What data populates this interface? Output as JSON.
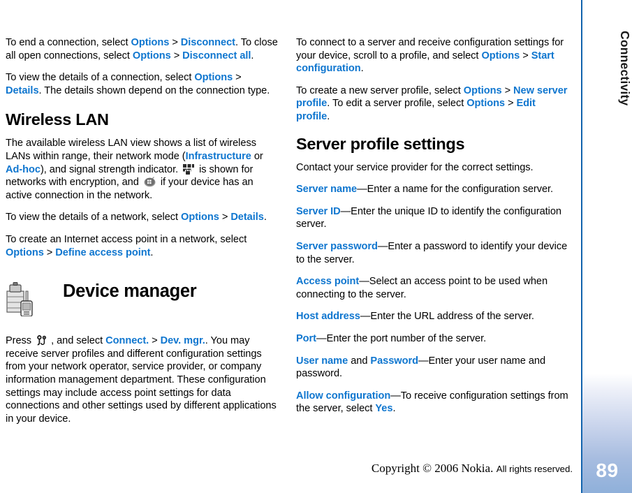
{
  "sidebar": {
    "chapter_label": "Connectivity",
    "page_number": "89",
    "accent_color": "#1263ad",
    "gradient_bottom_color": "#8fb0da"
  },
  "theme": {
    "link_color": "#0f76cf",
    "text_color": "#000000"
  },
  "left_column": {
    "p1": {
      "t1": "To end a connection, select ",
      "l1": "Options",
      "t2": " > ",
      "l2": "Disconnect",
      "t3": ". To close all open connections, select ",
      "l3": "Options",
      "t4": " > ",
      "l4": "Disconnect all",
      "t5": "."
    },
    "p2": {
      "t1": "To view the details of a connection, select ",
      "l1": "Options",
      "t2": " > ",
      "l2": "Details",
      "t3": ". The details shown depend on the connection type."
    },
    "heading_wireless_lan": "Wireless LAN",
    "p3": {
      "t1": "The available wireless LAN view shows a list of wireless LANs within range, their network mode (",
      "l1": "Infrastructure",
      "t2": " or ",
      "l2": "Ad-hoc",
      "t3": "), and signal strength indicator. ",
      "icon1": "wlan-encrypted-icon",
      "t4": " is shown for networks with encryption, and ",
      "icon2": "wlan-active-connection-icon",
      "t5": " if your device has an active connection in the network."
    },
    "p4": {
      "t1": "To view the details of a network, select ",
      "l1": "Options",
      "t2": " > ",
      "l2": "Details",
      "t3": "."
    },
    "p5": {
      "t1": "To create an Internet access point in a network, select ",
      "l1": "Options",
      "t2": " > ",
      "l2": "Define access point",
      "t3": "."
    },
    "chapter": {
      "icon": "device-manager-icon",
      "title": "Device manager"
    },
    "p6": {
      "t1": "Press ",
      "icon1": "menu-key-icon",
      "t2": ", and select ",
      "l1": "Connect.",
      "t3": " > ",
      "l2": "Dev. mgr.",
      "t4": ". You may receive server profiles and different configuration settings from your network operator, service provider, or company information management department. These configuration settings may include access point settings for data connections and other settings used by different applications in your device."
    }
  },
  "right_column": {
    "p1": {
      "t1": "To connect to a server and receive configuration settings for your device, scroll to a profile, and select ",
      "l1": "Options",
      "t2": " > ",
      "l2": "Start configuration",
      "t3": "."
    },
    "p2": {
      "t1": "To create a new server profile, select ",
      "l1": "Options",
      "t2": " > ",
      "l2": "New server profile",
      "t3": ". To edit a server profile, select ",
      "l3": "Options",
      "t4": " > ",
      "l4": "Edit profile",
      "t5": "."
    },
    "heading_server_profile_settings": "Server profile settings",
    "p3": {
      "t1": "Contact your service provider for the correct settings."
    },
    "p4": {
      "l1": "Server name",
      "t1": "—Enter a name for the configuration server."
    },
    "p5": {
      "l1": "Server ID",
      "t1": "—Enter the unique ID to identify the configuration server."
    },
    "p6": {
      "l1": "Server password",
      "t1": "—Enter a password to identify your device to the server."
    },
    "p7": {
      "l1": "Access point",
      "t1": "—Select an access point to be used when connecting to the server."
    },
    "p8": {
      "l1": "Host address",
      "t1": "—Enter the URL address of the server."
    },
    "p9": {
      "l1": "Port",
      "t1": "—Enter the port number of the server."
    },
    "p10": {
      "l1": "User name",
      "t1": " and ",
      "l2": "Password",
      "t2": "—Enter your user name and password."
    },
    "p11": {
      "l1": "Allow configuration",
      "t1": "—To receive configuration settings from the server, select ",
      "l2": "Yes",
      "t2": "."
    }
  },
  "footer": {
    "copyright_serif": "Copyright © 2006 Nokia.",
    "copyright_sans": "All rights reserved."
  }
}
